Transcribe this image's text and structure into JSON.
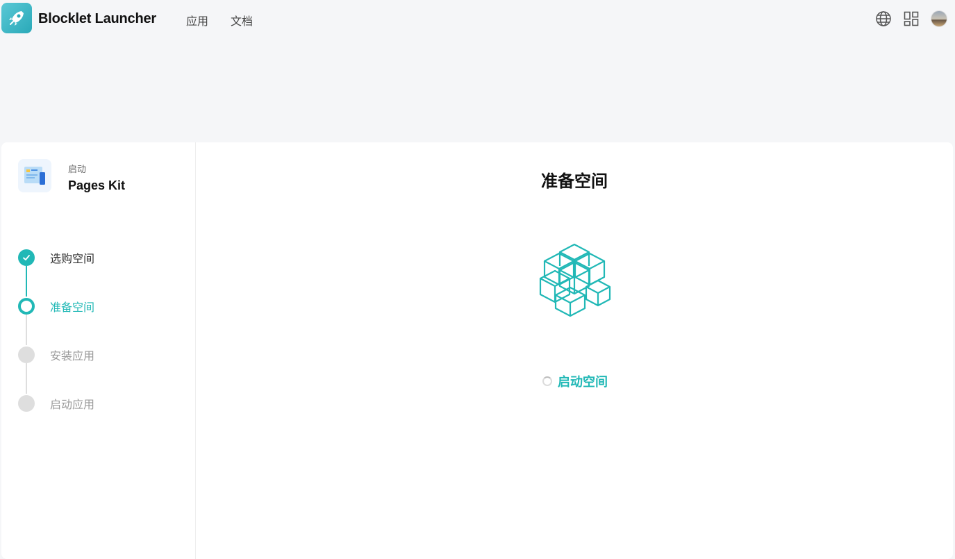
{
  "header": {
    "brand": "Blocklet Launcher",
    "nav": [
      {
        "label": "应用"
      },
      {
        "label": "文档"
      }
    ],
    "icons": [
      "globe-icon",
      "apps-grid-icon",
      "avatar"
    ]
  },
  "sidebar": {
    "launch_label": "启动",
    "app_name": "Pages Kit",
    "steps": [
      {
        "label": "选购空间",
        "state": "done"
      },
      {
        "label": "准备空间",
        "state": "active"
      },
      {
        "label": "安装应用",
        "state": "pending"
      },
      {
        "label": "启动应用",
        "state": "pending"
      }
    ]
  },
  "main": {
    "title": "准备空间",
    "status_text": "启动空间"
  },
  "colors": {
    "accent": "#21b8b6",
    "pending": "#dedede",
    "background": "#f5f6f8"
  }
}
